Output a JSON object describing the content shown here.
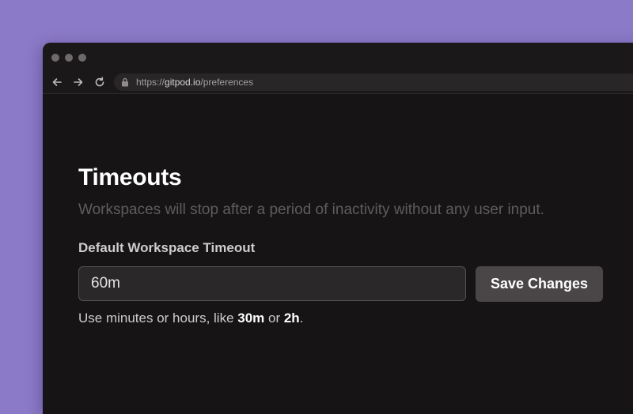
{
  "browser": {
    "url_scheme": "https://",
    "url_host": "gitpod.io",
    "url_path": "/preferences",
    "icons": {
      "back": "arrow-left-icon",
      "forward": "arrow-right-icon",
      "reload": "reload-icon",
      "lock": "lock-icon"
    }
  },
  "section": {
    "title": "Timeouts",
    "description": "Workspaces will stop after a period of inactivity without any user input."
  },
  "timeout_field": {
    "label": "Default Workspace Timeout",
    "value": "60m",
    "hint_prefix": "Use minutes or hours, like ",
    "hint_example_1": "30m",
    "hint_or": " or ",
    "hint_example_2": "2h",
    "hint_suffix": "."
  },
  "actions": {
    "save_label": "Save Changes"
  },
  "colors": {
    "background": "#8b7ac7",
    "window": "#161415",
    "button": "#4a4647"
  }
}
